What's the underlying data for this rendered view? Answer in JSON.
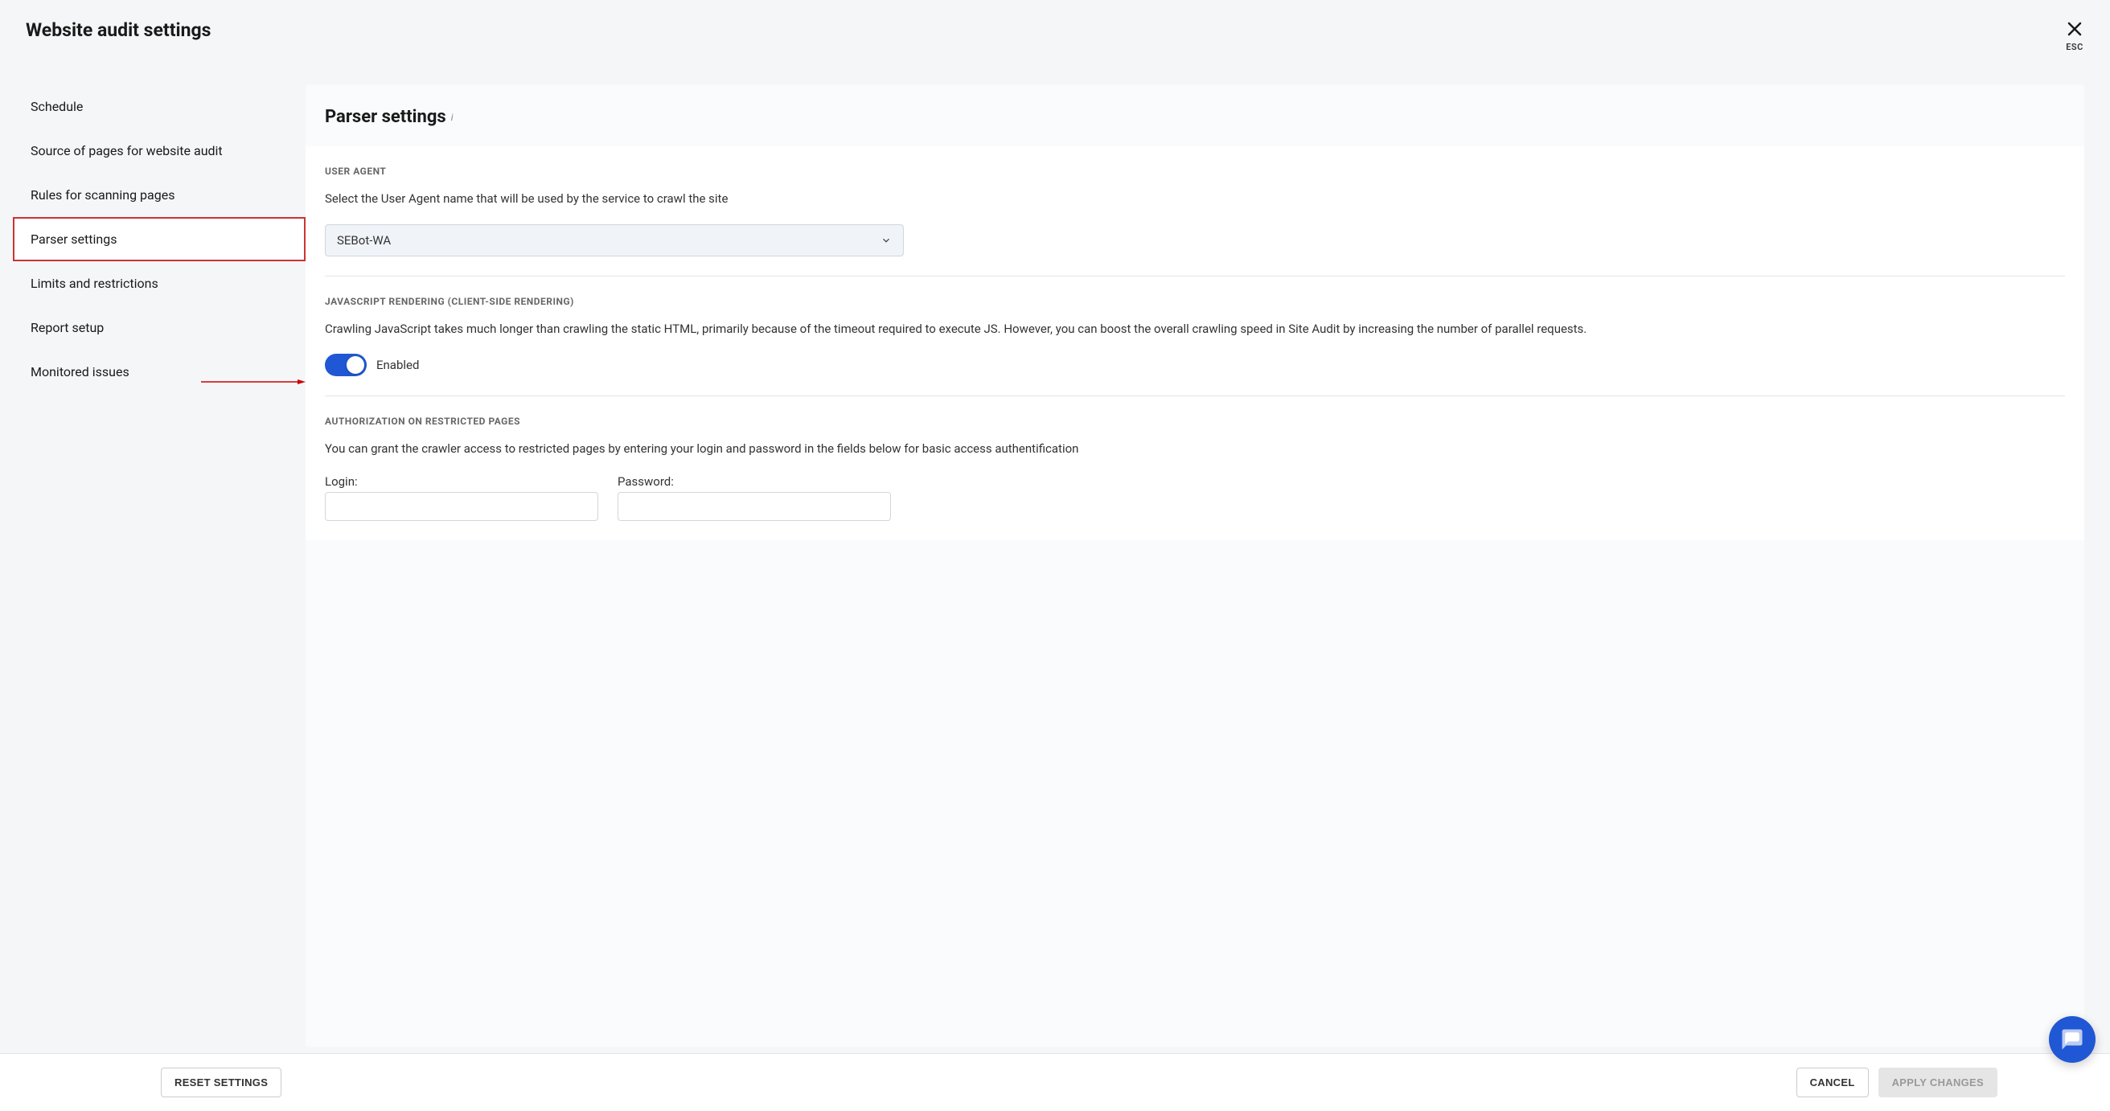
{
  "header": {
    "title": "Website audit settings",
    "escLabel": "ESC"
  },
  "sidebar": {
    "items": [
      {
        "label": "Schedule",
        "active": false
      },
      {
        "label": "Source of pages for website audit",
        "active": false
      },
      {
        "label": "Rules for scanning pages",
        "active": false
      },
      {
        "label": "Parser settings",
        "active": true
      },
      {
        "label": "Limits and restrictions",
        "active": false
      },
      {
        "label": "Report setup",
        "active": false
      },
      {
        "label": "Monitored issues",
        "active": false
      }
    ]
  },
  "content": {
    "title": "Parser settings",
    "sections": {
      "userAgent": {
        "title": "USER AGENT",
        "desc": "Select the User Agent name that will be used by the service to crawl the site",
        "selected": "SEBot-WA"
      },
      "jsRendering": {
        "title": "JAVASCRIPT RENDERING (CLIENT-SIDE RENDERING)",
        "desc": "Crawling JavaScript takes much longer than crawling the static HTML, primarily because of the timeout required to execute JS. However, you can boost the overall crawling speed in Site Audit by increasing the number of parallel requests.",
        "toggleLabel": "Enabled",
        "toggleState": true
      },
      "auth": {
        "title": "AUTHORIZATION ON RESTRICTED PAGES",
        "desc": "You can grant the crawler access to restricted pages by entering your login and password in the fields below for basic access authentification",
        "loginLabel": "Login:",
        "passwordLabel": "Password:",
        "loginValue": "",
        "passwordValue": ""
      }
    }
  },
  "footer": {
    "reset": "RESET SETTINGS",
    "cancel": "CANCEL",
    "apply": "APPLY CHANGES"
  }
}
